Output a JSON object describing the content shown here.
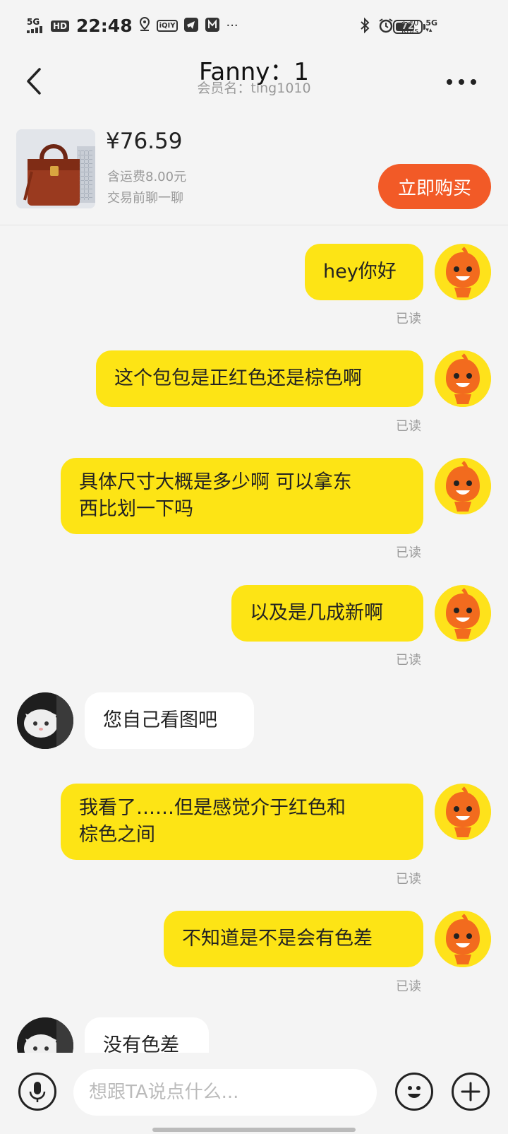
{
  "status_bar": {
    "network": "5G",
    "hd": "HD",
    "time": "22:48",
    "iqiyi": "iQIY",
    "speed_value": "1.40",
    "speed_unit": "KB/s",
    "network_right": "5G",
    "battery": "72",
    "more_dots": "···"
  },
  "header": {
    "title": "Fanny：1",
    "member_label": "会员名：ting1010"
  },
  "product": {
    "price": "¥76.59",
    "shipping": "含运费8.00元",
    "note": "交易前聊一聊",
    "buy_label": "立即购买"
  },
  "messages": [
    {
      "from": "me",
      "text": "hey你好",
      "status": "已读"
    },
    {
      "from": "me",
      "text": "这个包包是正红色还是棕色啊",
      "status": "已读"
    },
    {
      "from": "me",
      "text_line1": "具体尺寸大概是多少啊 可以拿东",
      "text_line2": "西比划一下吗",
      "status": "已读"
    },
    {
      "from": "me",
      "text": "以及是几成新啊",
      "status": "已读"
    },
    {
      "from": "them",
      "text": "您自己看图吧"
    },
    {
      "from": "me",
      "text_line1": "我看了……但是感觉介于红色和",
      "text_line2": "棕色之间",
      "status": "已读"
    },
    {
      "from": "me",
      "text": "不知道是不是会有色差",
      "status": "已读"
    },
    {
      "from": "them",
      "text": "没有色差"
    }
  ],
  "input_bar": {
    "placeholder": "想跟TA说点什么..."
  },
  "colors": {
    "my_bubble": "#fde415",
    "their_bubble": "#ffffff",
    "buy_button": "#f25a27",
    "background": "#f4f4f4"
  },
  "icons": [
    "back-arrow-icon",
    "more-icon",
    "microphone-icon",
    "emoji-icon",
    "plus-icon"
  ]
}
